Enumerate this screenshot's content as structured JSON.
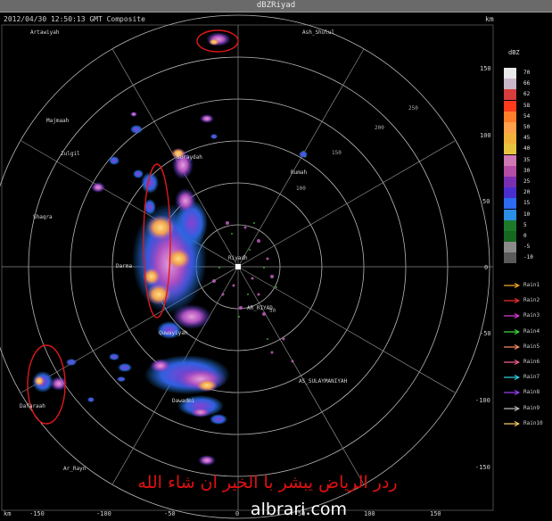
{
  "window": {
    "title": "dBZRiyad"
  },
  "header": {
    "timestamp": "2012/04/30 12:50:13 GMT Composite",
    "km_label": "km"
  },
  "legend": {
    "unit": "dBZ",
    "scale": [
      {
        "value": "70",
        "color": "#e8e8e8"
      },
      {
        "value": "66",
        "color": "#c9b7c9"
      },
      {
        "value": "62",
        "color": "#d83c3c"
      },
      {
        "value": "58",
        "color": "#ff3b1c"
      },
      {
        "value": "54",
        "color": "#ff7d2a"
      },
      {
        "value": "50",
        "color": "#ffa04a"
      },
      {
        "value": "45",
        "color": "#f2b13a"
      },
      {
        "value": "40",
        "color": "#e6c440"
      },
      {
        "value": "35",
        "color": "#cf78b4"
      },
      {
        "value": "30",
        "color": "#b54ca5"
      },
      {
        "value": "25",
        "color": "#7a2fb0"
      },
      {
        "value": "20",
        "color": "#4a2fd0"
      },
      {
        "value": "15",
        "color": "#2d6bf0"
      },
      {
        "value": "10",
        "color": "#2c8fe6"
      },
      {
        "value": "5",
        "color": "#1c7a2a"
      },
      {
        "value": "0",
        "color": "#176820"
      },
      {
        "value": "-5",
        "color": "#8a8a8a"
      },
      {
        "value": "-10",
        "color": "#5a5a5a"
      }
    ],
    "rain": [
      {
        "label": "Rain1",
        "color": "#ffb020"
      },
      {
        "label": "Rain2",
        "color": "#ff3030"
      },
      {
        "label": "Rain3",
        "color": "#e040e0"
      },
      {
        "label": "Rain4",
        "color": "#40e040"
      },
      {
        "label": "Rain5",
        "color": "#ff9060"
      },
      {
        "label": "Rain6",
        "color": "#ff6090"
      },
      {
        "label": "Rain7",
        "color": "#30d8e8"
      },
      {
        "label": "Rain8",
        "color": "#a040ff"
      },
      {
        "label": "Rain9",
        "color": "#c0c0c0"
      },
      {
        "label": "Rain10",
        "color": "#ffd060"
      }
    ]
  },
  "map": {
    "places": [
      {
        "name": "Artawiyah"
      },
      {
        "name": "Ash_Shulul"
      },
      {
        "name": "Majmaah"
      },
      {
        "name": "Zulgil"
      },
      {
        "name": "Buraydah"
      },
      {
        "name": "Rumah"
      },
      {
        "name": "Shaqra"
      },
      {
        "name": "Darma"
      },
      {
        "name": "Riyadh"
      },
      {
        "name": "AR_RIYAD"
      },
      {
        "name": "AS_SULAYMANIYAH"
      },
      {
        "name": "Dawadmi"
      },
      {
        "name": "Quwayiyah"
      },
      {
        "name": "Dafaraah"
      },
      {
        "name": "Ar_Rayn"
      }
    ],
    "y_ticks": [
      "150",
      "100",
      "50",
      "0",
      "-50",
      "-100",
      "-150"
    ],
    "x_ticks": [
      "-150",
      "-100",
      "-50",
      "0",
      "50",
      "100",
      "150"
    ],
    "corner_km": "km",
    "range_labels": [
      "50",
      "100",
      "150",
      "200",
      "250"
    ]
  },
  "caption": {
    "arabic": "ردر الرياض يبشر با الخير ان شاء الله",
    "watermark": "albrari.com"
  }
}
